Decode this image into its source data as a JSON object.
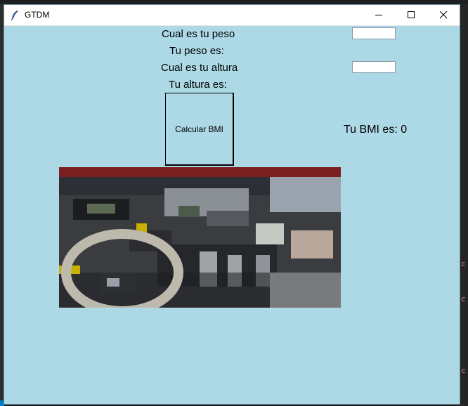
{
  "window": {
    "title": "GTDM"
  },
  "form": {
    "peso_label": "Cual es tu peso",
    "peso_result_label": "Tu peso es:",
    "altura_label": "Cual es tu altura",
    "altura_result_label": "Tu altura es:",
    "peso_value": "",
    "altura_value": "",
    "calc_button_label": "Calcular BMI",
    "bmi_result": "Tu BMI es: 0"
  },
  "icons": {
    "app": "feather-icon",
    "minimize": "minimize-icon",
    "maximize": "maximize-icon",
    "close": "close-icon"
  },
  "colors": {
    "window_background": "#add8e6",
    "titlebar": "#ffffff"
  }
}
